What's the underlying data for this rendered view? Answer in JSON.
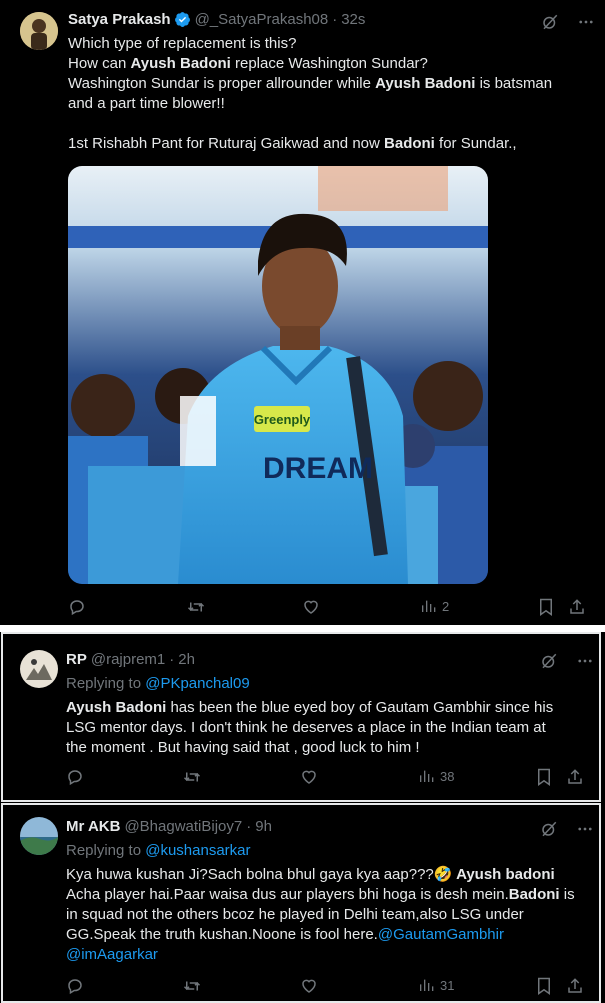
{
  "tweet": {
    "author_name": "Satya Prakash",
    "handle": "@_SatyaPrakash08",
    "time": "32s",
    "lines": [
      "Which type of replacement is this?",
      "How can ",
      "Ayush Badoni",
      " replace Washington Sundar?",
      "Washington Sundar is proper allrounder while ",
      "Ayush Badoni",
      " is batsman",
      "and a part time blower!!",
      "1st Rishabh Pant for Ruturaj Gaikwad and now ",
      "Badoni",
      " for Sundar.,"
    ],
    "image_jersey_text": "DREAM",
    "image_sponsor": "Greenply",
    "views": "2"
  },
  "reply1": {
    "author_name": "RP",
    "handle": "@rajprem1",
    "time": "2h",
    "replying_prefix": "Replying to ",
    "replying_to": "@PKpanchal09",
    "bold_start": "Ayush Badoni",
    "text_1": " has been the blue eyed boy of Gautam Gambhir since his",
    "text_2": "LSG  mentor days. I don't think he deserves a place in the Indian team at",
    "text_3": "the moment . But having said that , good luck to him !",
    "views": "38"
  },
  "reply2": {
    "author_name": "Mr AKB",
    "handle": "@BhagwatiBijoy7",
    "time": "9h",
    "replying_prefix": "Replying to ",
    "replying_to": "@kushansarkar",
    "line1_a": "Kya huwa kushan Ji?Sach bolna bhul gaya kya aap???",
    "emoji": "🤣",
    "line1_bold": " Ayush badoni",
    "line2_a": "Acha player hai.Paar waisa dus aur players bhi hoga is desh mein.",
    "line2_bold": "Badoni",
    "line2_b": " is",
    "line3": "in squad not the others bcoz he played in Delhi team,also LSG under",
    "line4": "GG.Speak the truth kushan.Noone is fool here.",
    "mention1": "@GautamGambhir",
    "mention2": "@imAagarkar",
    "views": "31"
  },
  "colors": {
    "accent": "#1d9bf0",
    "muted": "#71767b",
    "text": "#e7e9ea",
    "background": "#000000"
  }
}
